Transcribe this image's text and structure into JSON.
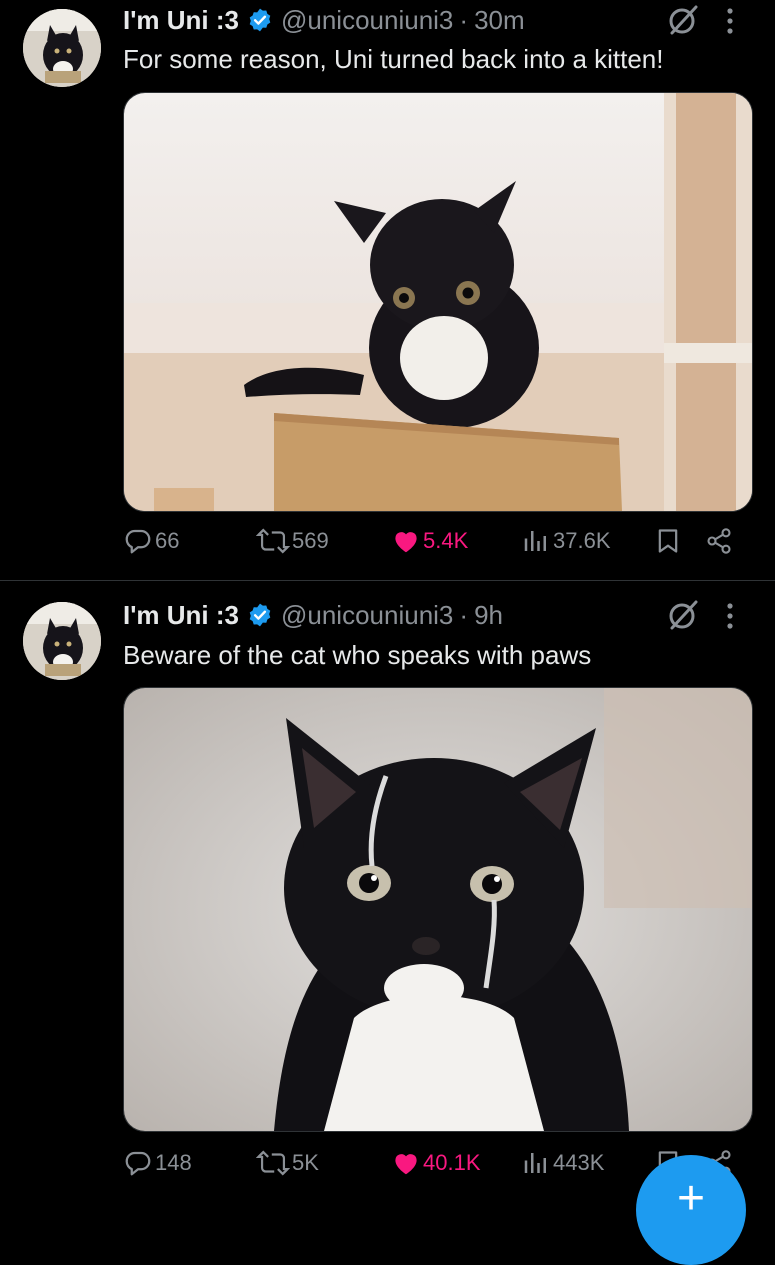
{
  "tweets": [
    {
      "author_name": "I'm Uni :3",
      "handle": "@unicouniuni3",
      "separator": "·",
      "time": "30m",
      "text": "For some reason, Uni turned back into a kitten!",
      "media_description": "black and white kitten sitting in a cardboard box",
      "replies": "66",
      "retweets": "569",
      "likes": "5.4K",
      "views": "37.6K"
    },
    {
      "author_name": "I'm Uni :3",
      "handle": "@unicouniuni3",
      "separator": "·",
      "time": "9h",
      "text": "Beware of the cat who speaks with paws",
      "media_description": "tuxedo cat with a string over its face",
      "replies": "148",
      "retweets": "5K",
      "likes": "40.1K",
      "views": "443K"
    }
  ],
  "colors": {
    "background": "#000000",
    "text": "#e7e9ea",
    "muted": "#8b9096",
    "like": "#f91880",
    "verified": "#1d9bf0",
    "fab": "#1d9bf0"
  },
  "icons": [
    "verified-badge-icon",
    "grok-icon",
    "more-icon",
    "reply-icon",
    "retweet-icon",
    "heart-icon",
    "views-icon",
    "bookmark-icon",
    "share-icon",
    "compose-icon"
  ],
  "fab_label": "+"
}
